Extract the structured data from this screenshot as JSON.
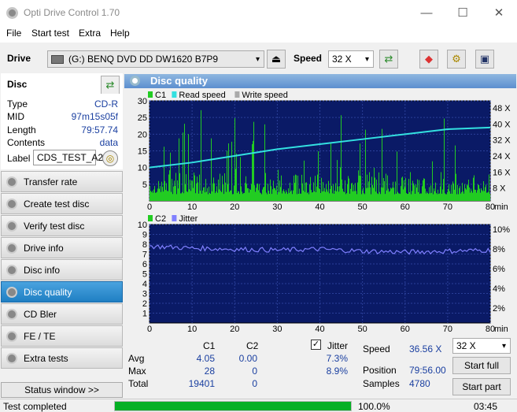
{
  "window": {
    "title": "Opti Drive Control 1.70",
    "minimize": "—",
    "maximize": "☐",
    "close": "✕"
  },
  "menu": [
    "File",
    "Start test",
    "Extra",
    "Help"
  ],
  "toolbar": {
    "drive_label": "Drive",
    "drive_value": "(G:)   BENQ DVD DD DW1620 B7P9",
    "speed_label": "Speed",
    "speed_value": "32 X"
  },
  "sidebar": {
    "title": "Disc",
    "info": [
      {
        "k": "Type",
        "v": "CD-R"
      },
      {
        "k": "MID",
        "v": "97m15s05f"
      },
      {
        "k": "Length",
        "v": "79:57.74"
      },
      {
        "k": "Contents",
        "v": "data"
      }
    ],
    "label_key": "Label",
    "label_value": "CDS_TEST_A2",
    "items": [
      "Transfer rate",
      "Create test disc",
      "Verify test disc",
      "Drive info",
      "Disc info",
      "Disc quality",
      "CD Bler",
      "FE / TE",
      "Extra tests"
    ],
    "active": 5,
    "status_window": "Status window >>"
  },
  "panel": {
    "title": "Disc quality"
  },
  "colors": {
    "c1": "#22cc22",
    "read": "#33e0e0",
    "write": "#aaaaaa",
    "c2": "#22cc22",
    "jitter": "#8080ff",
    "bg": "#0a1a66"
  },
  "chart_data": [
    {
      "type": "line",
      "legend": [
        "C1",
        "Read speed",
        "Write speed"
      ],
      "ylim": [
        0,
        30
      ],
      "y_ticks": [
        5,
        10,
        15,
        20,
        25,
        30
      ],
      "y2_ticks": [
        "48 X",
        "40 X",
        "32 X",
        "24 X",
        "16 X",
        "8 X"
      ],
      "xlim": [
        0,
        80
      ],
      "x_ticks": [
        0,
        10,
        20,
        30,
        40,
        50,
        60,
        70,
        80
      ],
      "x_unit": "min",
      "read_speed": {
        "x": [
          0,
          10,
          20,
          30,
          40,
          50,
          60,
          70,
          80
        ],
        "y": [
          10,
          11.5,
          13.5,
          15.5,
          17,
          18.5,
          20,
          21.5,
          22
        ]
      },
      "c1_avg": 4.05,
      "c1_max": 28
    },
    {
      "type": "line",
      "legend": [
        "C2",
        "Jitter"
      ],
      "ylim": [
        0,
        10
      ],
      "y_ticks": [
        1,
        2,
        3,
        4,
        5,
        6,
        7,
        8,
        9,
        10
      ],
      "y2_ticks": [
        "10%",
        "8%",
        "6%",
        "4%",
        "2%"
      ],
      "xlim": [
        0,
        80
      ],
      "x_ticks": [
        0,
        10,
        20,
        30,
        40,
        50,
        60,
        70,
        80
      ],
      "x_unit": "min",
      "jitter": {
        "x": [
          0,
          10,
          20,
          30,
          40,
          50,
          60,
          70,
          80
        ],
        "y": [
          7.8,
          7.6,
          7.5,
          7.4,
          7.5,
          7.3,
          7.2,
          7.3,
          7.4
        ]
      }
    }
  ],
  "stats": {
    "headers": [
      "C1",
      "C2"
    ],
    "rows": [
      {
        "label": "Avg",
        "c1": "4.05",
        "c2": "0.00",
        "j": "7.3%"
      },
      {
        "label": "Max",
        "c1": "28",
        "c2": "0",
        "j": "8.9%"
      },
      {
        "label": "Total",
        "c1": "19401",
        "c2": "0",
        "j": ""
      }
    ],
    "jitter_label": "Jitter",
    "jitter_checked": "✓",
    "speed_label": "Speed",
    "speed_value": "36.56 X",
    "position_label": "Position",
    "position_value": "79:56.00",
    "samples_label": "Samples",
    "samples_value": "4780",
    "speed_select": "32 X",
    "start_full": "Start full",
    "start_part": "Start part"
  },
  "status": {
    "text": "Test completed",
    "progress": 100,
    "progress_text": "100.0%",
    "time": "03:45"
  }
}
